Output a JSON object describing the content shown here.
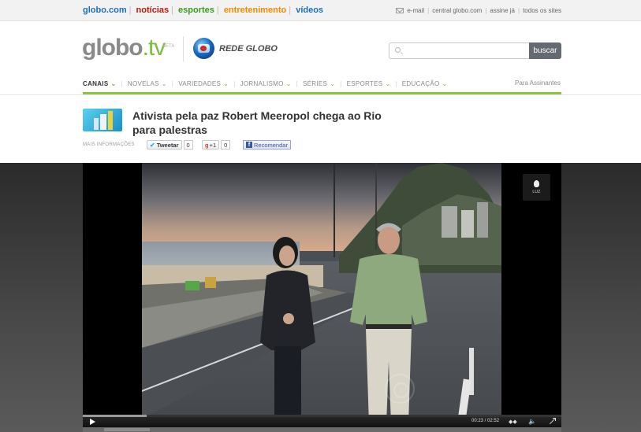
{
  "topbar": {
    "portals": [
      {
        "label": "globo.com",
        "color": "#1d6fb8"
      },
      {
        "label": "notícias",
        "color": "#c4170c"
      },
      {
        "label": "esportes",
        "color": "#3a9a1a"
      },
      {
        "label": "entretenimento",
        "color": "#f08c00"
      },
      {
        "label": "vídeos",
        "color": "#1d6fb8"
      }
    ],
    "links": [
      "e-mail",
      "central globo.com",
      "assine já",
      "todos os sites"
    ]
  },
  "header": {
    "logo_main": "globo",
    "logo_dot_tv": ".tv",
    "beta": "BETA",
    "channel": "REDE GLOBO",
    "search_placeholder": "",
    "search_button": "buscar"
  },
  "nav": {
    "items": [
      "CANAIS",
      "NOVELAS",
      "VARIEDADES",
      "JORNALISMO",
      "SÉRIES",
      "ESPORTES",
      "EDUCAÇÃO"
    ],
    "right_link": "Para Assinantes",
    "accent": "#8cc63f"
  },
  "article": {
    "title": "Ativista pela paz Robert Meeropol chega ao Rio para palestras",
    "mais_informacoes": "MAIS INFORMAÇÕES",
    "tweet_label": "Tweetar",
    "tweet_count": "0",
    "gplus_label": "+1",
    "gplus_count": "0",
    "facebook_label": "Recomendar"
  },
  "player": {
    "light_label": "LUZ",
    "time_current": "00:23",
    "time_total": "02:52",
    "progress": 0.134
  }
}
